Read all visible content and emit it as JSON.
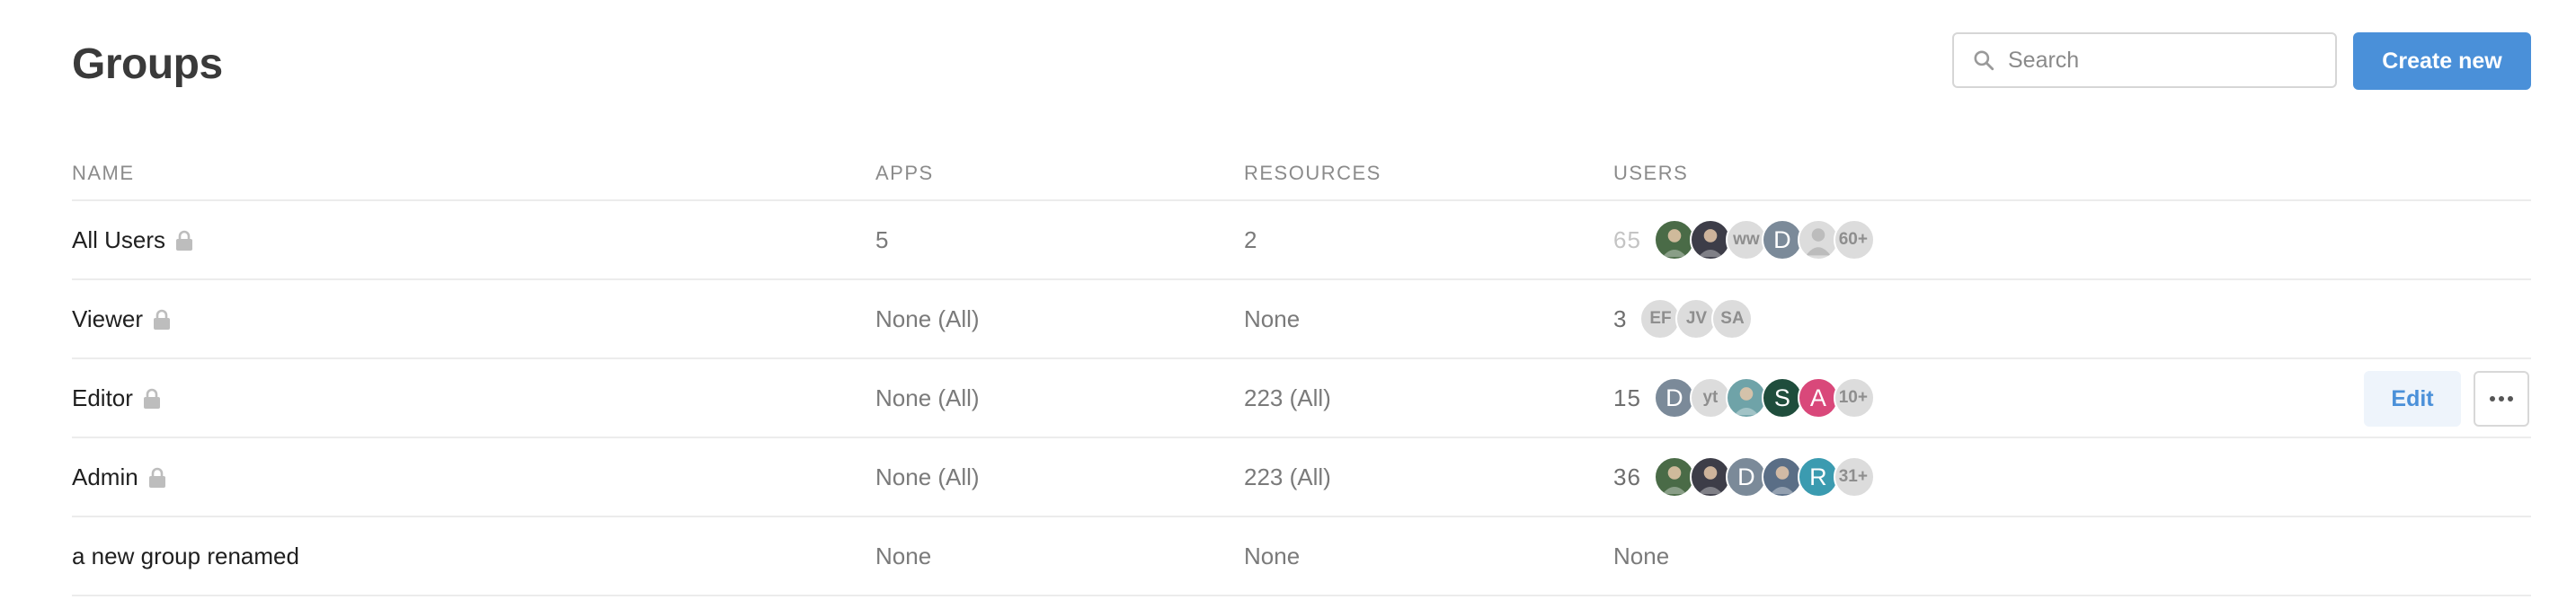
{
  "page": {
    "title": "Groups"
  },
  "search": {
    "placeholder": "Search",
    "value": ""
  },
  "actions": {
    "create_label": "Create new",
    "edit_label": "Edit",
    "more_icon": "ellipsis-icon"
  },
  "colors": {
    "accent": "#4a90d9",
    "edit_bg": "#eef4fb"
  },
  "table": {
    "columns": [
      "NAME",
      "APPS",
      "RESOURCES",
      "USERS"
    ],
    "rows": [
      {
        "name": "All Users",
        "locked": true,
        "apps": "5",
        "resources": "2",
        "users_count": "65",
        "count_faded": true,
        "avatars": [
          {
            "kind": "photo",
            "color": "#4a6b47"
          },
          {
            "kind": "photo",
            "color": "#3d3d48"
          },
          {
            "kind": "initials",
            "text": "ww",
            "color": "#dcdcdc"
          },
          {
            "kind": "letter",
            "text": "D",
            "color": "#7b8a99"
          },
          {
            "kind": "silhouette",
            "color": "#dcdcdc"
          },
          {
            "kind": "more",
            "text": "60+"
          }
        ]
      },
      {
        "name": "Viewer",
        "locked": true,
        "apps": "None (All)",
        "resources": "None",
        "users_count": "3",
        "count_faded": false,
        "avatars": [
          {
            "kind": "initials",
            "text": "EF",
            "color": "#dcdcdc"
          },
          {
            "kind": "initials",
            "text": "JV",
            "color": "#dcdcdc"
          },
          {
            "kind": "initials",
            "text": "SA",
            "color": "#dcdcdc"
          }
        ]
      },
      {
        "name": "Editor",
        "locked": true,
        "apps": "None (All)",
        "resources": "223 (All)",
        "users_count": "15",
        "count_faded": false,
        "hovered": true,
        "avatars": [
          {
            "kind": "letter",
            "text": "D",
            "color": "#7b8a99"
          },
          {
            "kind": "initials",
            "text": "yt",
            "color": "#dcdcdc"
          },
          {
            "kind": "photo",
            "color": "#6fa3a8"
          },
          {
            "kind": "letter",
            "text": "S",
            "color": "#1f4d3c"
          },
          {
            "kind": "letter",
            "text": "A",
            "color": "#d9487a"
          },
          {
            "kind": "more",
            "text": "10+"
          }
        ]
      },
      {
        "name": "Admin",
        "locked": true,
        "apps": "None (All)",
        "resources": "223 (All)",
        "users_count": "36",
        "count_faded": false,
        "avatars": [
          {
            "kind": "photo",
            "color": "#4a6b47"
          },
          {
            "kind": "photo",
            "color": "#3d3d48"
          },
          {
            "kind": "letter",
            "text": "D",
            "color": "#7b8a99"
          },
          {
            "kind": "photo",
            "color": "#5a6e86"
          },
          {
            "kind": "letter",
            "text": "R",
            "color": "#3b9bb0"
          },
          {
            "kind": "more",
            "text": "31+"
          }
        ]
      },
      {
        "name": "a new group renamed",
        "locked": false,
        "apps": "None",
        "resources": "None",
        "users_text": "None"
      }
    ]
  }
}
